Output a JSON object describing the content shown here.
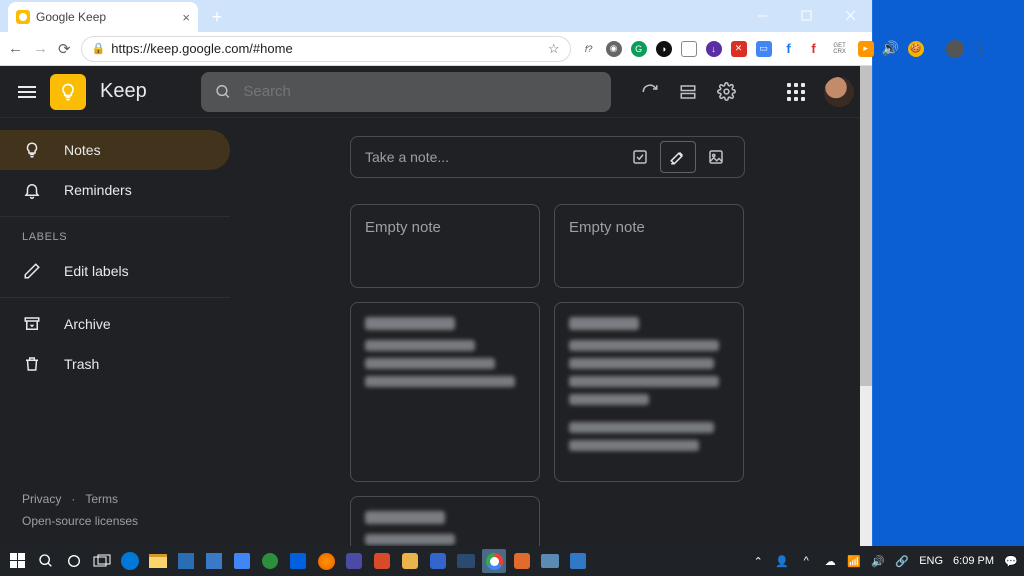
{
  "browser": {
    "tab_title": "Google Keep",
    "url": "https://keep.google.com/#home"
  },
  "header": {
    "brand": "Keep",
    "search_placeholder": "Search"
  },
  "sidebar": {
    "items": [
      {
        "label": "Notes"
      },
      {
        "label": "Reminders"
      }
    ],
    "labels_heading": "LABELS",
    "edit_labels": "Edit labels",
    "archive": "Archive",
    "trash": "Trash"
  },
  "footer": {
    "privacy": "Privacy",
    "terms": "Terms",
    "licenses": "Open-source licenses"
  },
  "compose": {
    "placeholder": "Take a note..."
  },
  "notes": {
    "empty_label": "Empty note"
  },
  "extensions": {
    "getcrx": "GET CRX"
  },
  "taskbar": {
    "lang": "ENG",
    "time": "6:09 PM"
  }
}
